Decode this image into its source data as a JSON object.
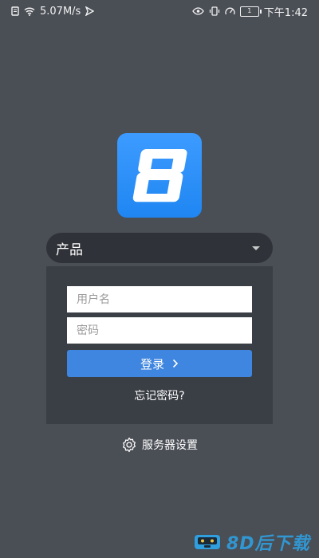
{
  "status_bar": {
    "network_speed": "5.07M/s",
    "battery_level": "1",
    "time": "下午1:42"
  },
  "app": {
    "logo_glyph": "8",
    "brand_color": "#2e8ef5"
  },
  "product_select": {
    "selected": "产品"
  },
  "login_form": {
    "username_placeholder": "用户名",
    "username_value": "",
    "password_placeholder": "密码",
    "password_value": "",
    "login_label": "登录",
    "forgot_label": "忘记密码?"
  },
  "footer": {
    "server_settings_label": "服务器设置"
  },
  "watermark": {
    "text": "8D后下载"
  }
}
